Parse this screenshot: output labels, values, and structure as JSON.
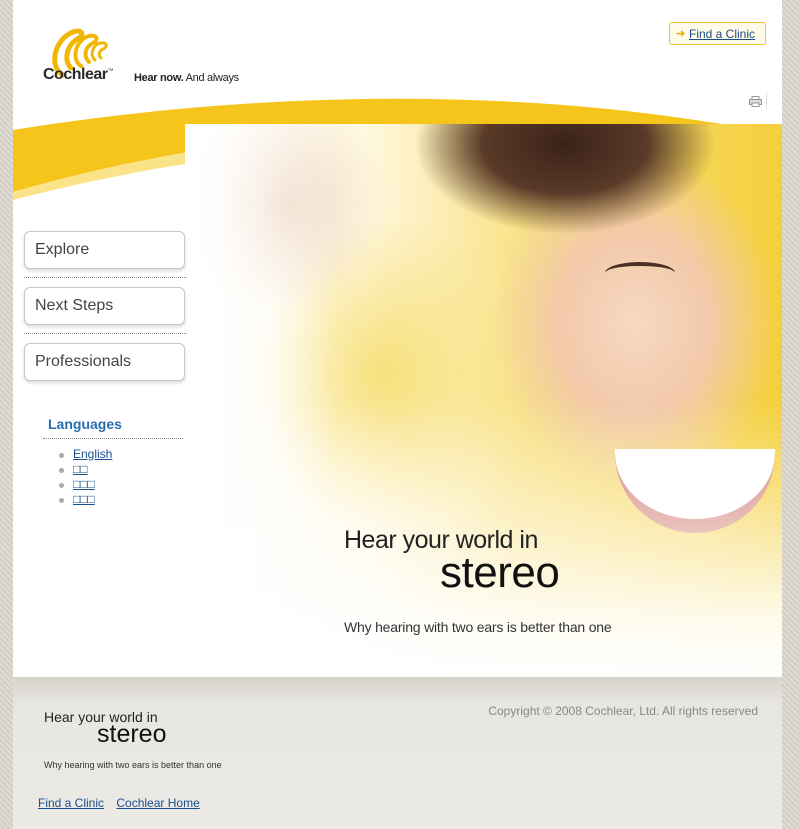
{
  "brand": {
    "name": "Cochlear",
    "tm": "™",
    "tagline_bold": "Hear now.",
    "tagline_rest": " And always"
  },
  "header": {
    "find_clinic": "Find a Clinic"
  },
  "nav": {
    "items": [
      {
        "label": "Explore"
      },
      {
        "label": "Next Steps"
      },
      {
        "label": "Professionals"
      }
    ]
  },
  "languages": {
    "title": "Languages",
    "items": [
      {
        "label": "English"
      },
      {
        "label": "□□"
      },
      {
        "label": "□□□"
      },
      {
        "label": "□□□"
      }
    ]
  },
  "hero": {
    "line1": "Hear your world in",
    "line2": "stereo",
    "line3": "Why hearing with two ears is better than one"
  },
  "footer": {
    "line1": "Hear your world in",
    "line2": "stereo",
    "line3": "Why hearing with two ears is better than one",
    "copyright": "Copyright © 2008 Cochlear, Ltd. All rights reserved",
    "links": [
      {
        "label": "Find a Clinic"
      },
      {
        "label": "Cochlear Home"
      }
    ]
  },
  "colors": {
    "accent_yellow": "#f4c21c",
    "link_blue": "#1a4d8c",
    "heading_blue": "#2a6db0"
  }
}
